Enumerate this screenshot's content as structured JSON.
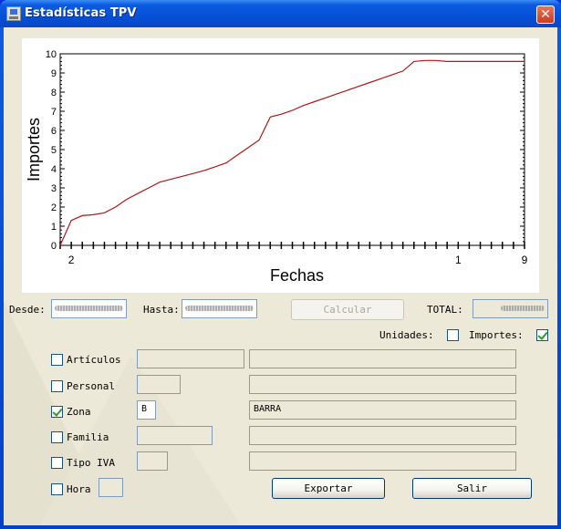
{
  "window": {
    "title": "Estadísticas TPV",
    "close_glyph": "✕"
  },
  "chart_data": {
    "type": "line",
    "xlabel": "Fechas",
    "ylabel": "Importes",
    "ylim": [
      0,
      10
    ],
    "yticks": [
      "0",
      "1",
      "2",
      "3",
      "4",
      "5",
      "6",
      "7",
      "8",
      "9",
      "10"
    ],
    "xtick_labels": [
      {
        "label": "2",
        "x": 1
      },
      {
        "label": "1",
        "x": 36
      },
      {
        "label": "9",
        "x": 42
      }
    ],
    "x_range": [
      0,
      42
    ],
    "series": [
      {
        "color": "#b01818",
        "x": [
          0,
          1,
          2,
          3,
          4,
          5,
          6,
          7,
          8,
          9,
          10,
          11,
          12,
          13,
          14,
          15,
          16,
          17,
          18,
          19,
          20,
          21,
          22,
          23,
          24,
          25,
          26,
          27,
          28,
          29,
          30,
          31,
          32,
          33,
          34,
          35,
          36,
          37,
          38,
          39,
          40,
          41,
          42
        ],
        "y": [
          0.0,
          1.3,
          1.55,
          1.6,
          1.7,
          2.0,
          2.4,
          2.7,
          3.0,
          3.3,
          3.45,
          3.6,
          3.75,
          3.9,
          4.1,
          4.3,
          4.7,
          5.1,
          5.5,
          6.7,
          6.85,
          7.05,
          7.3,
          7.5,
          7.7,
          7.9,
          8.1,
          8.3,
          8.5,
          8.7,
          8.9,
          9.1,
          9.6,
          9.65,
          9.65,
          9.6,
          9.6,
          9.6,
          9.6,
          9.6,
          9.6,
          9.6,
          9.6
        ]
      }
    ]
  },
  "filters": {
    "desde_label": "Desde:",
    "hasta_label": "Hasta:",
    "calcular_label": "Calcular",
    "total_label": "TOTAL:",
    "unidades_label": "Unidades:",
    "importes_label": "Importes:",
    "unidades_checked": false,
    "importes_checked": true
  },
  "rows": [
    {
      "label": "Artículos",
      "checked": false,
      "code": "",
      "desc": ""
    },
    {
      "label": "Personal",
      "checked": false,
      "code": "",
      "desc": ""
    },
    {
      "label": "Zona",
      "checked": true,
      "code": "B",
      "desc": "BARRA"
    },
    {
      "label": "Familia",
      "checked": false,
      "code": "",
      "desc": ""
    },
    {
      "label": "Tipo IVA",
      "checked": false,
      "code": "",
      "desc": ""
    },
    {
      "label": "Hora",
      "checked": false,
      "code": ""
    }
  ],
  "buttons": {
    "exportar": "Exportar",
    "salir": "Salir"
  }
}
